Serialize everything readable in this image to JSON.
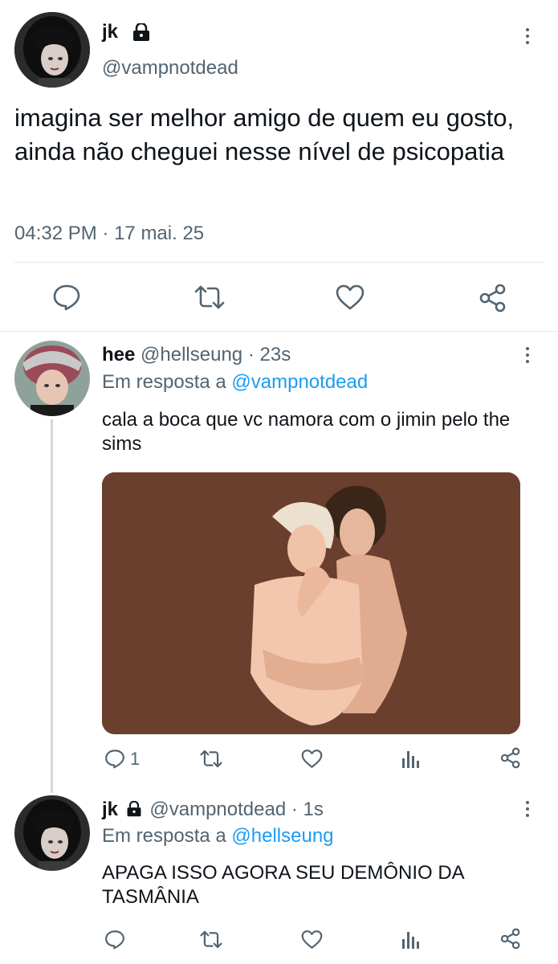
{
  "main_tweet": {
    "display_name": "jk",
    "handle": "@vampnotdead",
    "text": "imagina ser melhor amigo de quem eu gosto, ainda não cheguei nesse nível de psicopatia",
    "time": "04:32 PM",
    "separator": "·",
    "date": "17 mai. 25"
  },
  "reply1": {
    "display_name": "hee",
    "handle": "@hellseung",
    "time_sep": "·",
    "age": "23s",
    "reply_prefix": "Em resposta a",
    "reply_to": "@vampnotdead",
    "text": "cala a boca que vc namora com o jimin pelo the sims",
    "reply_count": "1"
  },
  "reply2": {
    "display_name": "jk",
    "handle": "@vampnotdead",
    "time_sep": "·",
    "age": "1s",
    "reply_prefix": "Em resposta a",
    "reply_to": "@hellseung",
    "text": "APAGA ISSO AGORA SEU DEMÔNIO DA TASMÂNIA"
  },
  "icons": {
    "reply": "reply-icon",
    "retweet": "retweet-icon",
    "like": "heart-icon",
    "views": "views-icon",
    "share": "share-icon",
    "lock": "lock-icon",
    "more": "more-icon"
  },
  "colors": {
    "text": "#0f1419",
    "secondary": "#536471",
    "link": "#1d9bf0",
    "divider": "#e6e9eb",
    "image_bg": "#6b3f2e"
  }
}
